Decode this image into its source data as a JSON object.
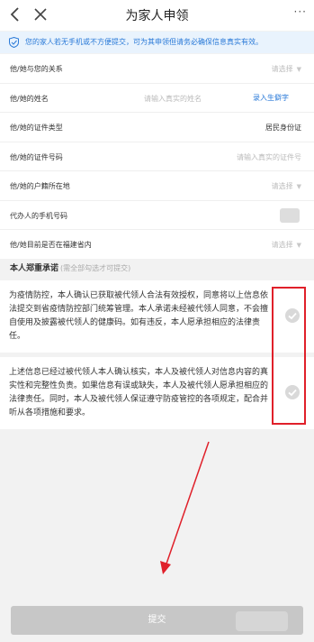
{
  "header": {
    "title": "为家人申领",
    "more": "···"
  },
  "notice": {
    "text": "您的家人若无手机或不方便提交，可为其申领但请务必确保信息真实有效。"
  },
  "form": {
    "rows": [
      {
        "label": "他/她与您的关系",
        "value": "请选择"
      },
      {
        "label": "他/她的姓名",
        "placeholder": "请输入真实的姓名",
        "action": "录入生僻字"
      },
      {
        "label": "他/她的证件类型",
        "value": "居民身份证"
      },
      {
        "label": "他/她的证件号码",
        "placeholder": "请输入真实的证件号"
      },
      {
        "label": "他/她的户籍所在地",
        "value": "请选择"
      },
      {
        "label": "代办人的手机号码"
      },
      {
        "label": "他/她目前是否在福建省内",
        "value": "请选择"
      }
    ]
  },
  "commitment": {
    "title": "本人郑重承诺",
    "subtitle": "(需全部勾选才可提交)",
    "items": [
      {
        "text": "为疫情防控，本人确认已获取被代领人合法有效授权，同意将以上信息依法提交到省疫情防控部门统筹管理。本人承诺未经被代领人同意，不会擅自使用及披露被代领人的健康码。如有违反，本人愿承担相应的法律责任。"
      },
      {
        "text": "上述信息已经过被代领人本人确认核实，本人及被代领人对信息内容的真实性和完整性负责。如果信息有误或缺失，本人及被代领人愿承担相应的法律责任。同时，本人及被代领人保证遵守防疫管控的各项规定，配合并听从各项措施和要求。"
      }
    ]
  },
  "submit": {
    "label": "提交"
  },
  "colors": {
    "accent": "#2a7ad8",
    "annotation": "#e0202a",
    "submit_disabled": "#c7c7c7"
  }
}
